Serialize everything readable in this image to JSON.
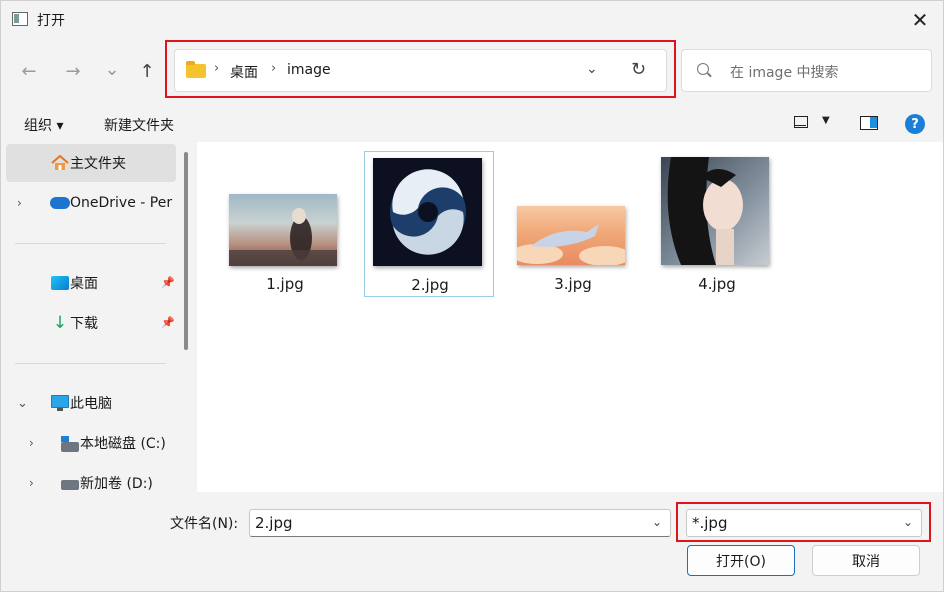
{
  "window": {
    "title": "打开"
  },
  "nav": {
    "back": "←",
    "forward": "→",
    "recent": "⌄",
    "up": "↑"
  },
  "address": {
    "crumbs": [
      "桌面",
      "image"
    ],
    "sep": "›",
    "dropdown": "⌄",
    "refresh": "↻"
  },
  "search": {
    "placeholder": "在 image 中搜索"
  },
  "toolbar": {
    "organize": "组织 ▾",
    "new_folder": "新建文件夹",
    "help": "?"
  },
  "sidebar": {
    "home": "主文件夹",
    "onedrive": "OneDrive - Per",
    "desktop": "桌面",
    "downloads": "下载",
    "this_pc": "此电脑",
    "drive_c": "本地磁盘 (C:)",
    "drive_d": "新加卷 (D:)"
  },
  "files": [
    {
      "name": "1.jpg",
      "selected": false
    },
    {
      "name": "2.jpg",
      "selected": true
    },
    {
      "name": "3.jpg",
      "selected": false
    },
    {
      "name": "4.jpg",
      "selected": false
    }
  ],
  "bottom": {
    "filename_label": "文件名(N):",
    "filename_value": "2.jpg",
    "filetype_value": "*.jpg",
    "open_button": "打开(O)",
    "cancel_button": "取消"
  },
  "colors": {
    "highlight": "#e0141c",
    "accent": "#1a6fc2",
    "selection": "#99cde6"
  }
}
